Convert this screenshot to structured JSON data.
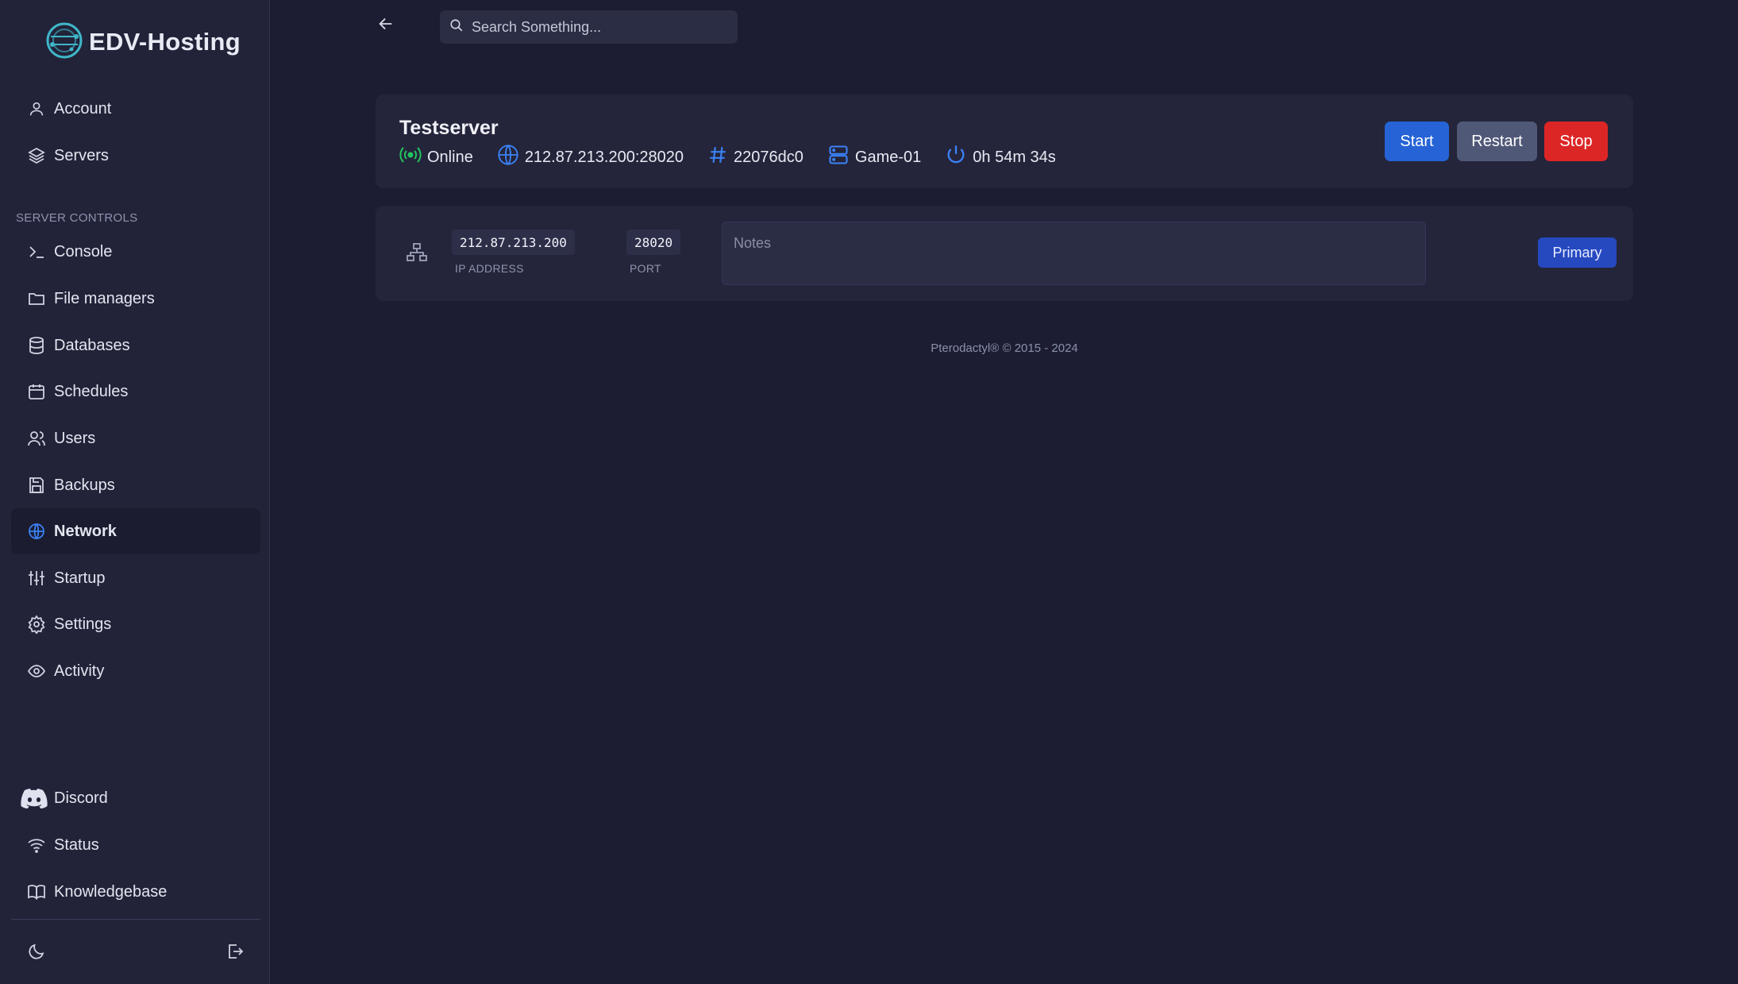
{
  "brand": {
    "name": "EDV-Hosting"
  },
  "sidebar": {
    "top_items": [
      {
        "label": "Account",
        "icon": "user-icon"
      },
      {
        "label": "Servers",
        "icon": "layers-icon"
      }
    ],
    "section_label": "SERVER CONTROLS",
    "server_items": [
      {
        "label": "Console",
        "icon": "terminal-icon"
      },
      {
        "label": "File managers",
        "icon": "folder-icon"
      },
      {
        "label": "Databases",
        "icon": "database-icon"
      },
      {
        "label": "Schedules",
        "icon": "calendar-icon"
      },
      {
        "label": "Users",
        "icon": "users-icon"
      },
      {
        "label": "Backups",
        "icon": "save-icon"
      },
      {
        "label": "Network",
        "icon": "globe-icon",
        "active": true
      },
      {
        "label": "Startup",
        "icon": "sliders-icon"
      },
      {
        "label": "Settings",
        "icon": "gear-icon"
      },
      {
        "label": "Activity",
        "icon": "eye-icon"
      }
    ],
    "bottom_items": [
      {
        "label": "Discord",
        "icon": "discord-icon"
      },
      {
        "label": "Status",
        "icon": "wifi-icon"
      },
      {
        "label": "Knowledgebase",
        "icon": "book-icon"
      }
    ]
  },
  "header": {
    "search_placeholder": "Search Something..."
  },
  "server": {
    "name": "Testserver",
    "status": "Online",
    "address": "212.87.213.200:28020",
    "id": "22076dc0",
    "node": "Game-01",
    "uptime": "0h 54m 34s",
    "buttons": {
      "start": "Start",
      "restart": "Restart",
      "stop": "Stop"
    }
  },
  "allocation": {
    "ip": "212.87.213.200",
    "ip_label": "IP ADDRESS",
    "port": "28020",
    "port_label": "PORT",
    "notes_placeholder": "Notes",
    "badge": "Primary"
  },
  "footer": {
    "text": "Pterodactyl® © 2015 - 2024"
  },
  "colors": {
    "background": "#1c1d33",
    "sidebar": "#222339",
    "accent": "#2563d6",
    "online": "#22c55e",
    "danger": "#dc2626"
  }
}
